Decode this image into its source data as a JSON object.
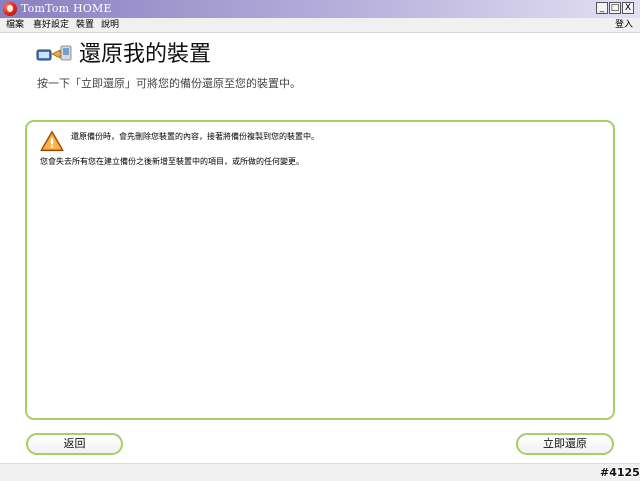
{
  "window": {
    "title": "TomTom HOME",
    "minimize_glyph": "_",
    "maximize_glyph": "□",
    "close_glyph": "X"
  },
  "menu": {
    "file": "檔案",
    "preferences": "喜好設定",
    "device": "裝置",
    "help": "說明",
    "login": "登入"
  },
  "header": {
    "title": "還原我的裝置",
    "instruction": "按一下「立即還原」可將您的備份還原至您的裝置中。",
    "icon": "restore-device-icon"
  },
  "content": {
    "warning_icon": "warning-triangle-icon",
    "warning_text": "還原備份時，會先刪除您裝置的內容，接著將備份複製到您的裝置中。",
    "info_text": "您會失去所有您在建立備份之後新增至裝置中的項目，或所做的任何變更。"
  },
  "buttons": {
    "back": "返回",
    "restore_now": "立即還原"
  },
  "watermark": "#4125",
  "colors": {
    "accent_green": "#a6cf6a",
    "titlebar_start": "#8a7fc0",
    "titlebar_end": "#e4e0f2",
    "warning_orange": "#f08a1c"
  }
}
